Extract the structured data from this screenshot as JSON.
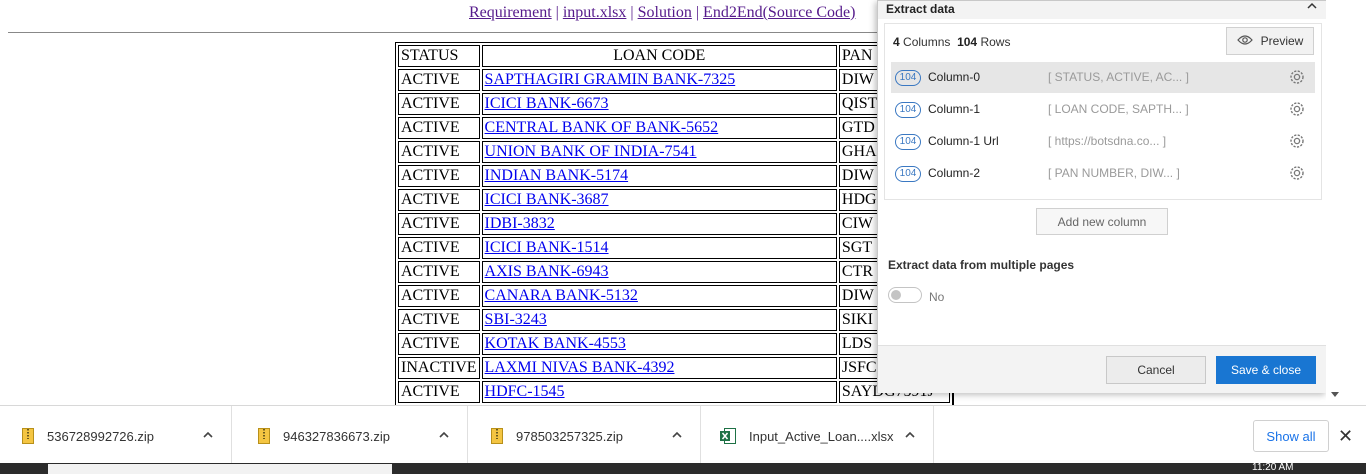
{
  "nav": {
    "links": [
      {
        "label": "Requirement"
      },
      {
        "label": "input.xlsx"
      },
      {
        "label": "Solution"
      },
      {
        "label": "End2End(Source Code)"
      }
    ],
    "separator": "|"
  },
  "table": {
    "headers": [
      "STATUS",
      "LOAN CODE",
      "PAN"
    ],
    "rows": [
      {
        "status": "ACTIVE",
        "loan": "SAPTHAGIRI GRAMIN BANK-7325",
        "pan": "DIW"
      },
      {
        "status": "ACTIVE",
        "loan": "ICICI BANK-6673",
        "pan": "QIST"
      },
      {
        "status": "ACTIVE",
        "loan": "CENTRAL BANK OF BANK-5652",
        "pan": "GTD"
      },
      {
        "status": "ACTIVE",
        "loan": "UNION BANK OF INDIA-7541",
        "pan": "GHA"
      },
      {
        "status": "ACTIVE",
        "loan": "INDIAN BANK-5174",
        "pan": "DIW"
      },
      {
        "status": "ACTIVE",
        "loan": "ICICI BANK-3687",
        "pan": "HDG"
      },
      {
        "status": "ACTIVE",
        "loan": "IDBI-3832",
        "pan": "CIW"
      },
      {
        "status": "ACTIVE",
        "loan": "ICICI BANK-1514",
        "pan": "SGT"
      },
      {
        "status": "ACTIVE",
        "loan": "AXIS BANK-6943",
        "pan": "CTR"
      },
      {
        "status": "ACTIVE",
        "loan": "CANARA BANK-5132",
        "pan": "DIW"
      },
      {
        "status": "ACTIVE",
        "loan": "SBI-3243",
        "pan": "SIKI"
      },
      {
        "status": "ACTIVE",
        "loan": "KOTAK BANK-4553",
        "pan": "LDS"
      },
      {
        "status": "INACTIVE",
        "loan": "LAXMI NIVAS BANK-4392",
        "pan": "JSFC"
      },
      {
        "status": "ACTIVE",
        "loan": "HDFC-1545",
        "pan": "SAYDG7591J"
      }
    ]
  },
  "panel": {
    "title": "Extract data",
    "columns_count": "4",
    "columns_label": "Columns",
    "rows_count": "104",
    "rows_label": "Rows",
    "preview_label": "Preview",
    "columns": [
      {
        "badge": "104",
        "name": "Column-0",
        "preview": "[ STATUS, ACTIVE, AC... ]",
        "selected": true
      },
      {
        "badge": "104",
        "name": "Column-1",
        "preview": "[ LOAN CODE, SAPTH... ]",
        "selected": false
      },
      {
        "badge": "104",
        "name": "Column-1 Url",
        "preview": "[ https://botsdna.co... ]",
        "selected": false
      },
      {
        "badge": "104",
        "name": "Column-2",
        "preview": "[ PAN NUMBER, DIW... ]",
        "selected": false
      }
    ],
    "add_column_label": "Add new column",
    "multi_pages_label": "Extract data from multiple pages",
    "toggle_label": "No",
    "cancel_label": "Cancel",
    "save_label": "Save & close"
  },
  "downloads": {
    "items": [
      {
        "name": "536728992726.zip",
        "icon": "zip-file-icon"
      },
      {
        "name": "946327836673.zip",
        "icon": "zip-file-icon"
      },
      {
        "name": "978503257325.zip",
        "icon": "zip-file-icon"
      },
      {
        "name": "Input_Active_Loan....xlsx",
        "icon": "excel-file-icon"
      }
    ],
    "show_all_label": "Show all",
    "close_glyph": "✕"
  },
  "taskbar": {
    "time": "11:20 AM"
  },
  "colors": {
    "accent": "#1976d2",
    "link": "#0000ee",
    "visited_link": "#551a8b",
    "badge": "#3a78c2"
  }
}
